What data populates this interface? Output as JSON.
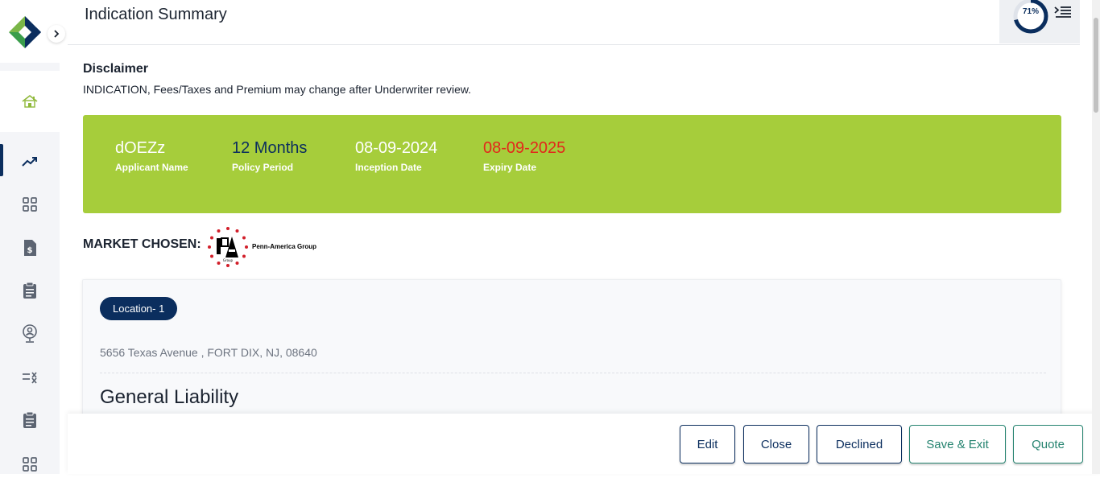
{
  "header": {
    "title": "Indication Summary"
  },
  "progress": {
    "value": 0.71,
    "label": "71%"
  },
  "disclaimer": {
    "title": "Disclaimer",
    "text": "INDICATION, Fees/Taxes and Premium may change after Underwriter review."
  },
  "summary": {
    "applicant": {
      "value": "dOEZz",
      "label": "Applicant Name"
    },
    "policy_period": {
      "value": "12 Months",
      "label": "Policy Period"
    },
    "inception": {
      "value": "08-09-2024",
      "label": "Inception Date"
    },
    "expiry": {
      "value": "08-09-2025",
      "label": "Expiry Date"
    }
  },
  "market": {
    "label": "MARKET CHOSEN:",
    "name": "Penn-America Group",
    "logo_text": "Group"
  },
  "location": {
    "pill": "Location- 1",
    "address": "5656 Texas Avenue , FORT DIX, NJ, 08640",
    "section": "General Liability"
  },
  "buttons": {
    "edit": "Edit",
    "close": "Close",
    "declined": "Declined",
    "save_exit": "Save & Exit",
    "quote": "Quote"
  },
  "colors": {
    "navy": "#0b2e5e",
    "banner_green": "#a6cd3b",
    "expiry_red": "#e3261b",
    "policy_period_blue": "#0b2e5e",
    "teal": "#24836f"
  },
  "sidebar": {
    "items": [
      "home-icon",
      "trending-icon",
      "grid-icon",
      "invoice-icon",
      "clipboard-icon",
      "location-person-icon",
      "checklist-icon",
      "clipboard-icon",
      "grid-icon"
    ]
  }
}
